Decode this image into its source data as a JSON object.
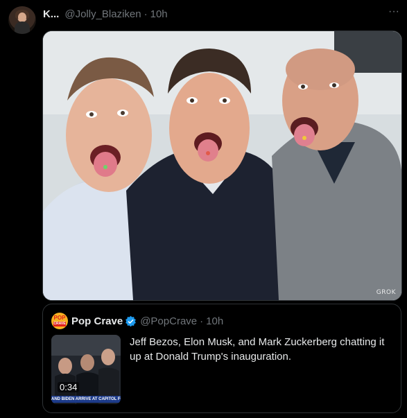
{
  "post": {
    "display_name": "K...",
    "handle": "@Jolly_Blaziken",
    "separator": "·",
    "time": "10h",
    "more_label": "···"
  },
  "photo": {
    "watermark": "GROK"
  },
  "quote": {
    "name": "Pop Crave",
    "handle": "@PopCrave",
    "separator": "·",
    "time": "10h",
    "text": "Jeff Bezos, Elon Musk, and Mark Zuckerberg chatting it up at Donald Trump's inauguration.",
    "video_duration": "0:34",
    "video_ticker": "AND BIDEN ARRIVE AT CAPITOL FOR",
    "avatar_text_top": "POP",
    "avatar_text_bottom": "CRAVE"
  },
  "colors": {
    "background": "#000000",
    "text_primary": "#e7e9ea",
    "text_secondary": "#71767b",
    "border": "#2f3336",
    "verified_blue": "#1d9bf0"
  }
}
